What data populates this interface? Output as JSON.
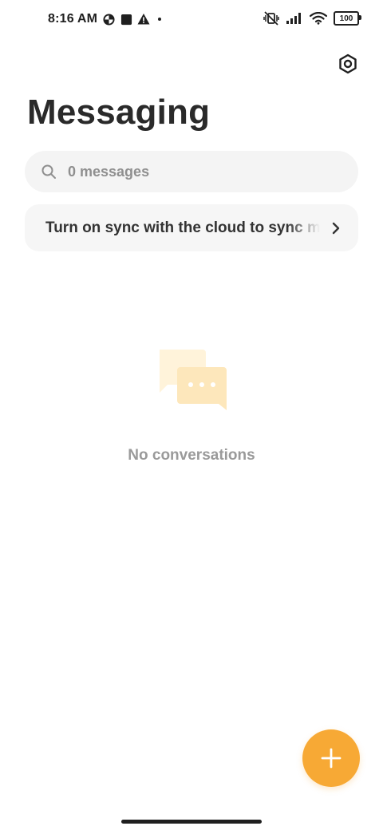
{
  "status_bar": {
    "time": "8:16 AM",
    "battery_level": "100",
    "icons": {
      "left": [
        "data-saver-icon",
        "notification-square-icon",
        "warning-icon",
        "dot-icon"
      ],
      "right": [
        "vibrate-off-icon",
        "signal-icon",
        "wifi-icon",
        "battery-icon"
      ]
    }
  },
  "header": {
    "title": "Messaging",
    "settings_icon": "settings-hexagon-icon"
  },
  "search": {
    "placeholder": "0 messages",
    "icon": "search-icon"
  },
  "sync_banner": {
    "text": "Turn on sync with the cloud to sync messages",
    "icon": "chevron-right-icon"
  },
  "empty_state": {
    "text": "No conversations",
    "illustration": "chat-bubbles-icon",
    "colors": {
      "back_bubble": "#fff3da",
      "front_bubble": "#fde7bb",
      "dots": "#ffffff"
    }
  },
  "fab": {
    "icon": "plus-icon",
    "color": "#f7a935"
  },
  "colors": {
    "accent": "#f7a935",
    "surface": "#f4f4f4",
    "text_primary": "#2a2a2a",
    "text_muted": "#9a9a9a"
  }
}
